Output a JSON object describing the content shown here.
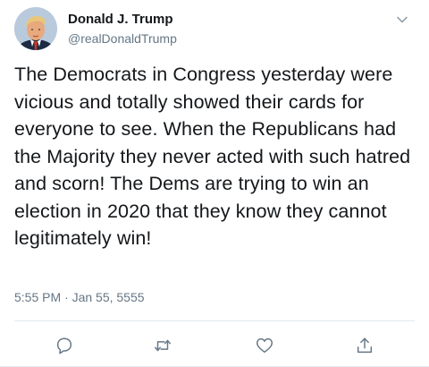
{
  "tweet": {
    "author": {
      "display_name": "Donald J. Trump",
      "handle": "@realDonaldTrump",
      "avatar_icon": "profile-photo"
    },
    "text": "The Democrats in Congress yesterday were vicious and totally showed their cards for everyone to see. When the Republicans had the Majority they never acted with such hatred and scorn! The Dems are trying to win an election in 2020 that they know they cannot legitimately win!",
    "timestamp": "5:55 PM · Jan 55, 5555",
    "menu_icon": "chevron-down-icon",
    "actions": [
      {
        "name": "reply",
        "icon": "reply-icon"
      },
      {
        "name": "retweet",
        "icon": "retweet-icon"
      },
      {
        "name": "like",
        "icon": "heart-icon"
      },
      {
        "name": "share",
        "icon": "share-icon"
      }
    ]
  },
  "colors": {
    "text": "#14171a",
    "secondary": "#657786",
    "divider": "#e1e8ed",
    "icon": "#657786"
  }
}
